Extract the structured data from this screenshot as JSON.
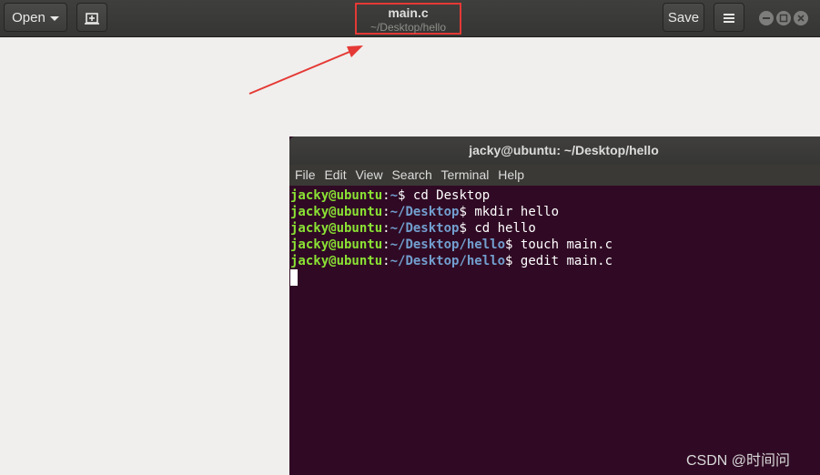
{
  "gedit": {
    "open_label": "Open",
    "save_label": "Save",
    "title": "main.c",
    "subtitle": "~/Desktop/hello"
  },
  "terminal": {
    "title": "jacky@ubuntu: ~/Desktop/hello",
    "menu": [
      "File",
      "Edit",
      "View",
      "Search",
      "Terminal",
      "Help"
    ],
    "lines": [
      {
        "user": "jacky@ubuntu",
        "path": "~",
        "cmd": " cd Desktop"
      },
      {
        "user": "jacky@ubuntu",
        "path": "~/Desktop",
        "cmd": " mkdir hello"
      },
      {
        "user": "jacky@ubuntu",
        "path": "~/Desktop",
        "cmd": " cd hello"
      },
      {
        "user": "jacky@ubuntu",
        "path": "~/Desktop/hello",
        "cmd": " touch main.c"
      },
      {
        "user": "jacky@ubuntu",
        "path": "~/Desktop/hello",
        "cmd": " gedit main.c"
      }
    ]
  },
  "watermark": "CSDN @时间问",
  "colors": {
    "terminal_bg": "#300a24",
    "prompt_user": "#8ae234",
    "prompt_path": "#729fcf",
    "annotation": "#e53935"
  },
  "icons": [
    "caret-down-icon",
    "new-tab-icon",
    "hamburger-menu-icon",
    "minimize-icon",
    "maximize-icon",
    "close-icon"
  ]
}
